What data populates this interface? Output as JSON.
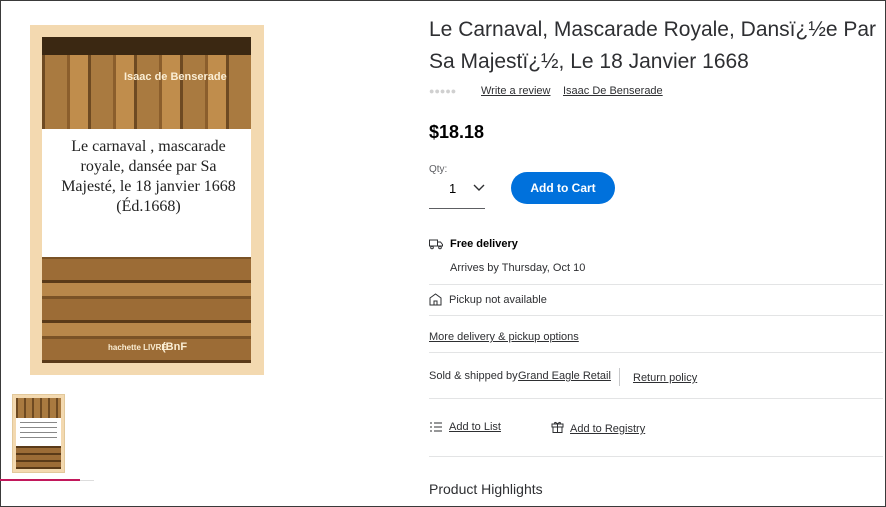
{
  "gallery": {
    "cover": {
      "author": "Isaac de Benserade",
      "title_lines": [
        "Le carnaval , mascarade",
        "royale, dansée par Sa",
        "Majesté, le 18 janvier 1668",
        "(Éd.1668)"
      ],
      "publisher": "hachette LIVRE",
      "library": "(BnF"
    }
  },
  "product": {
    "title": "Le Carnaval, Mascarade Royale, Dansï¿½e Par Sa Majestï¿½, Le 18 Janvier 1668",
    "write_review": "Write a review",
    "author": "Isaac De Benserade",
    "price": "$18.18"
  },
  "quantity": {
    "label": "Qty:",
    "value": "1"
  },
  "cart": {
    "button_label": "Add to Cart",
    "accent": "#0071dc"
  },
  "fulfillment": {
    "delivery_title": "Free delivery",
    "delivery_date": "Arrives by Thursday, Oct 10",
    "pickup": "Pickup not available",
    "more_options": "More delivery & pickup options"
  },
  "seller": {
    "sold_by_label": "Sold & shipped by",
    "seller_name": "Grand Eagle Retail",
    "return_policy": "Return policy"
  },
  "actions": {
    "add_to_list": "Add to List",
    "add_to_registry": "Add to Registry"
  },
  "sections": {
    "highlights": "Product Highlights"
  },
  "icons": {
    "delivery": "truck-icon",
    "pickup": "store-icon",
    "list": "list-icon",
    "registry": "gift-icon",
    "quantity": "chevron-down-icon",
    "rating": "star-icon"
  }
}
